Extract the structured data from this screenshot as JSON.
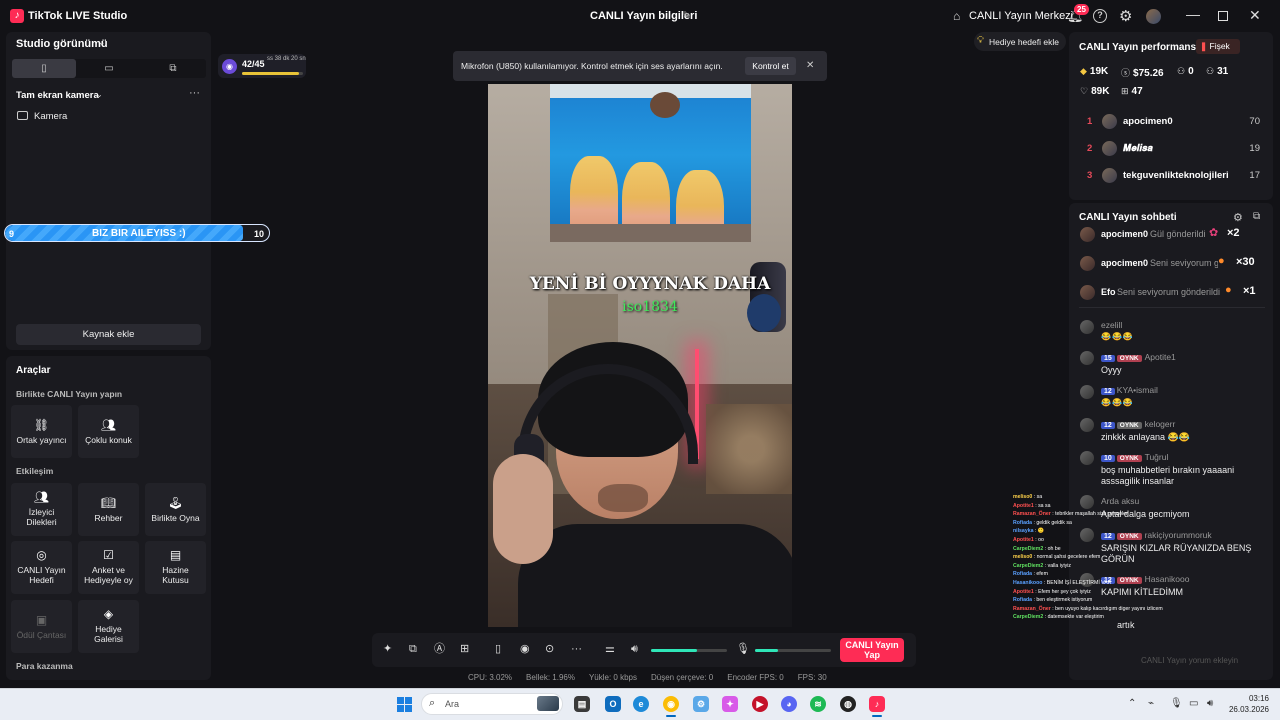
{
  "titlebar": {
    "app_title": "TikTok LIVE Studio",
    "center_title": "CANLI Yayın bilgileri",
    "live_center": "CANLI Yayın Merkezi",
    "notification_count": "25"
  },
  "left": {
    "studio_view": "Studio görünümü",
    "fullscreen_camera": "Tam ekran kamera",
    "camera_label": "Kamera",
    "add_source": "Kaynak ekle",
    "tools_title": "Araçlar",
    "section_live_together": "Birlikte CANLI Yayın yapın",
    "section_interaction": "Etkileşim",
    "section_earn": "Para kazanma",
    "tools": {
      "co_host": "Ortak yayıncı",
      "multi_guest": "Çoklu konuk",
      "viewer_wishes_1": "İzleyici",
      "viewer_wishes_2": "Dilekleri",
      "guide": "Rehber",
      "play_together": "Birlikte Oyna",
      "live_goal_1": "CANLI Yayın",
      "live_goal_2": "Hedefi",
      "poll_1": "Anket ve",
      "poll_2": "Hediyeyle oy",
      "treasure_1": "Hazine",
      "treasure_2": "Kutusu",
      "reward_bag": "Ödül Çantası",
      "gift_gallery_1": "Hediye",
      "gift_gallery_2": "Galerisi"
    }
  },
  "goal_bar": {
    "start": "9",
    "label": "BIZ BIR AILEYISS :)",
    "end": "10",
    "progress": 0.9
  },
  "level_pill": {
    "count": "42/45",
    "time": "ss 38 dk 20 sn",
    "progress": 0.93
  },
  "toast": {
    "text": "Mikrofon (U850) kullanılamıyor. Kontrol etmek için ses ayarlarını açın.",
    "button": "Kontrol et"
  },
  "gift_goal_button": "Hediye hedefi ekle",
  "overlay_text": {
    "line1": "YENİ Bİ OYYYNAK DAHA",
    "line2": "iso1834"
  },
  "controls": {
    "go_live_1": "CANLI Yayın",
    "go_live_2": "Yap",
    "speaker_level": 0.6,
    "mic_level": 0.3
  },
  "stats": {
    "cpu": "CPU:  3.02%",
    "memory": "Bellek:  1.96%",
    "upload": "Yükle:  0 kbps",
    "dropped": "Düşen çerçeve:  0",
    "encoder_fps": "Encoder FPS:  0",
    "fps": "FPS:  30"
  },
  "performance": {
    "title": "CANLI Yayın performansı",
    "firework": "Fişek",
    "diamonds": "19K",
    "money": "$75.26",
    "new_followers": "0",
    "viewers": "31",
    "likes": "89K",
    "gifters": "47"
  },
  "ranking": [
    {
      "rank": "1",
      "name": "apocimen0",
      "score": "70"
    },
    {
      "rank": "2",
      "name": "𝑴𝒆𝒍𝒊𝒔𝒂",
      "score": "19"
    },
    {
      "rank": "3",
      "name": "tekguvenlikteknolojileri",
      "score": "17"
    }
  ],
  "chat": {
    "title": "CANLI Yayın sohbeti",
    "gifts": [
      {
        "name": "apocimen0",
        "text": "Gül gönderildi",
        "count": "×2"
      },
      {
        "name": "apocimen0",
        "text": "Seni seviyorum g",
        "count": "×30"
      },
      {
        "name": "Efo",
        "text": "Seni seviyorum gönderildi",
        "count": "×1"
      }
    ],
    "messages": [
      {
        "user": "ezelill",
        "level": "",
        "tag": "",
        "text": "😂😂😂"
      },
      {
        "user": "Apotite1",
        "level": "15",
        "tag": "OYNK",
        "text": "Oyyy"
      },
      {
        "user": "KYA•ismail",
        "level": "12",
        "tag": "",
        "text": "😂😂😂"
      },
      {
        "user": "kelogerr",
        "level": "12",
        "tag": "OYNK",
        "text": "zinkkk anlayana 😂😂"
      },
      {
        "user": "Tuğrul",
        "level": "10",
        "tag": "OYNK",
        "text": "boş muhabbetleri bırakın yaaaani asssagilik insanlar"
      },
      {
        "user": "Arda aksu",
        "level": "",
        "tag": "",
        "text": "Aptal dalga gecmiyom"
      },
      {
        "user": "rakiçiyorummoruk",
        "level": "12",
        "tag": "OYNK",
        "text": "SARIŞIN KIZLAR RÜYANIZDA BENŞ GÖRÜN"
      },
      {
        "user": "Hasanikooo",
        "level": "12",
        "tag": "OYNK",
        "text": "KAPIMI KİTLEDİMM"
      },
      {
        "user": "",
        "level": "",
        "tag": "",
        "text": "artık"
      }
    ],
    "input_placeholder": "CANLI Yayın yorum ekleyin"
  },
  "overlay_chat": [
    {
      "name": "meliso0",
      "text": ": sa"
    },
    {
      "name": "Apotite1",
      "text": ": sa sa"
    },
    {
      "name": "Ramazan_Öner",
      "text": ": tebrikler maşallah size gençoler"
    },
    {
      "name": "Rofiada",
      "text": ": geldik geldik sa"
    },
    {
      "name": "nilsayka",
      "text": ": 🙂"
    },
    {
      "name": "Apotite1",
      "text": ": oo"
    },
    {
      "name": "CarpeDiem2",
      "text": ": oh be"
    },
    {
      "name": "meliso0",
      "text": ": normal şahsi gecelere efem"
    },
    {
      "name": "CarpeDiem2",
      "text": ": valla iyiyiz"
    },
    {
      "name": "Rofiada",
      "text": ": efem"
    },
    {
      "name": "Hasanikooo",
      "text": ": BENİM İŞİ ELEŞTİRMİ VAR"
    },
    {
      "name": "Apotite1",
      "text": ": Efem her şey çok iyiyiz"
    },
    {
      "name": "Rofiada",
      "text": ": ben eleştirmek istiyorum"
    },
    {
      "name": "Ramazan_Öner",
      "text": ": ben uyuyo kalıp kacırdıgım diger yayını izlicem"
    },
    {
      "name": "CarpeDiem2",
      "text": ": datemsekte var eleştirim"
    }
  ],
  "taskbar": {
    "search": "Ara",
    "time": "03:16",
    "date": "26.03.2026"
  },
  "colors": {
    "accent": "#fe2c55",
    "goal_bar": "#2a95f5",
    "slider": "#2fe6b8",
    "level_badge": "#3d56c8"
  }
}
